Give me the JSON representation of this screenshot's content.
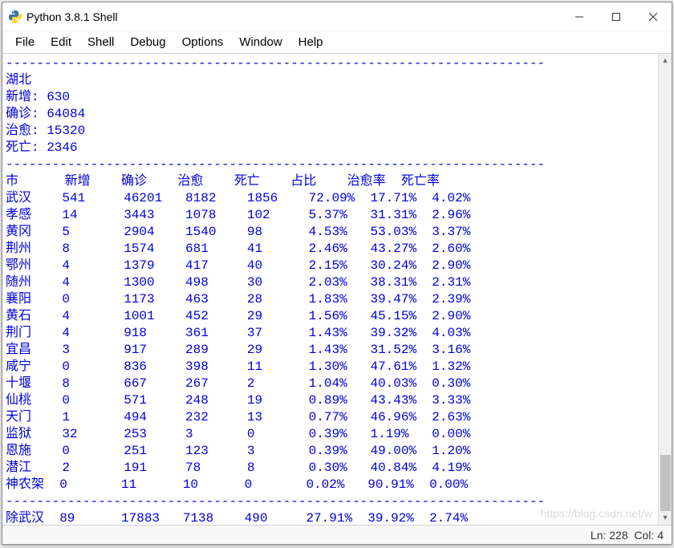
{
  "window": {
    "title": "Python 3.8.1 Shell"
  },
  "menu": {
    "items": [
      "File",
      "Edit",
      "Shell",
      "Debug",
      "Options",
      "Window",
      "Help"
    ]
  },
  "output": {
    "sep": "----------------------------------------------------------------------",
    "province": "湖北",
    "summary_rows": [
      {
        "label": "新增:",
        "value": "630"
      },
      {
        "label": "确诊:",
        "value": "64084"
      },
      {
        "label": "治愈:",
        "value": "15320"
      },
      {
        "label": "死亡:",
        "value": "2346"
      }
    ],
    "columns": [
      "市",
      "新增",
      "确诊",
      "治愈",
      "死亡",
      "占比",
      "治愈率",
      "死亡率"
    ],
    "rows": [
      {
        "city": "武汉",
        "add": "541",
        "conf": "46201",
        "cure": "8182",
        "dead": "1856",
        "pct": "72.09%",
        "crate": "17.71%",
        "drate": "4.02%"
      },
      {
        "city": "孝感",
        "add": "14",
        "conf": "3443",
        "cure": "1078",
        "dead": "102",
        "pct": "5.37%",
        "crate": "31.31%",
        "drate": "2.96%"
      },
      {
        "city": "黄冈",
        "add": "5",
        "conf": "2904",
        "cure": "1540",
        "dead": "98",
        "pct": "4.53%",
        "crate": "53.03%",
        "drate": "3.37%"
      },
      {
        "city": "荆州",
        "add": "8",
        "conf": "1574",
        "cure": "681",
        "dead": "41",
        "pct": "2.46%",
        "crate": "43.27%",
        "drate": "2.60%"
      },
      {
        "city": "鄂州",
        "add": "4",
        "conf": "1379",
        "cure": "417",
        "dead": "40",
        "pct": "2.15%",
        "crate": "30.24%",
        "drate": "2.90%"
      },
      {
        "city": "随州",
        "add": "4",
        "conf": "1300",
        "cure": "498",
        "dead": "30",
        "pct": "2.03%",
        "crate": "38.31%",
        "drate": "2.31%"
      },
      {
        "city": "襄阳",
        "add": "0",
        "conf": "1173",
        "cure": "463",
        "dead": "28",
        "pct": "1.83%",
        "crate": "39.47%",
        "drate": "2.39%"
      },
      {
        "city": "黄石",
        "add": "4",
        "conf": "1001",
        "cure": "452",
        "dead": "29",
        "pct": "1.56%",
        "crate": "45.15%",
        "drate": "2.90%"
      },
      {
        "city": "荆门",
        "add": "4",
        "conf": "918",
        "cure": "361",
        "dead": "37",
        "pct": "1.43%",
        "crate": "39.32%",
        "drate": "4.03%"
      },
      {
        "city": "宜昌",
        "add": "3",
        "conf": "917",
        "cure": "289",
        "dead": "29",
        "pct": "1.43%",
        "crate": "31.52%",
        "drate": "3.16%"
      },
      {
        "city": "咸宁",
        "add": "0",
        "conf": "836",
        "cure": "398",
        "dead": "11",
        "pct": "1.30%",
        "crate": "47.61%",
        "drate": "1.32%"
      },
      {
        "city": "十堰",
        "add": "8",
        "conf": "667",
        "cure": "267",
        "dead": "2",
        "pct": "1.04%",
        "crate": "40.03%",
        "drate": "0.30%"
      },
      {
        "city": "仙桃",
        "add": "0",
        "conf": "571",
        "cure": "248",
        "dead": "19",
        "pct": "0.89%",
        "crate": "43.43%",
        "drate": "3.33%"
      },
      {
        "city": "天门",
        "add": "1",
        "conf": "494",
        "cure": "232",
        "dead": "13",
        "pct": "0.77%",
        "crate": "46.96%",
        "drate": "2.63%"
      },
      {
        "city": "监狱",
        "add": "32",
        "conf": "253",
        "cure": "3",
        "dead": "0",
        "pct": "0.39%",
        "crate": "1.19%",
        "drate": "0.00%"
      },
      {
        "city": "恩施",
        "add": "0",
        "conf": "251",
        "cure": "123",
        "dead": "3",
        "pct": "0.39%",
        "crate": "49.00%",
        "drate": "1.20%"
      },
      {
        "city": "潜江",
        "add": "2",
        "conf": "191",
        "cure": "78",
        "dead": "8",
        "pct": "0.30%",
        "crate": "40.84%",
        "drate": "4.19%"
      },
      {
        "city": "神农架",
        "add": "0",
        "conf": "11",
        "cure": "10",
        "dead": "0",
        "pct": "0.02%",
        "crate": "90.91%",
        "drate": "0.00%"
      }
    ],
    "total_label": "除武汉",
    "total_row": {
      "add": "89",
      "conf": "17883",
      "cure": "7138",
      "dead": "490",
      "pct": "27.91%",
      "crate": "39.92%",
      "drate": "2.74%"
    },
    "prompt": ">>> "
  },
  "status": {
    "line_label": "Ln:",
    "line": "228",
    "col_label": "Col:",
    "col": "4"
  },
  "watermark": "https://blog.csdn.net/w"
}
